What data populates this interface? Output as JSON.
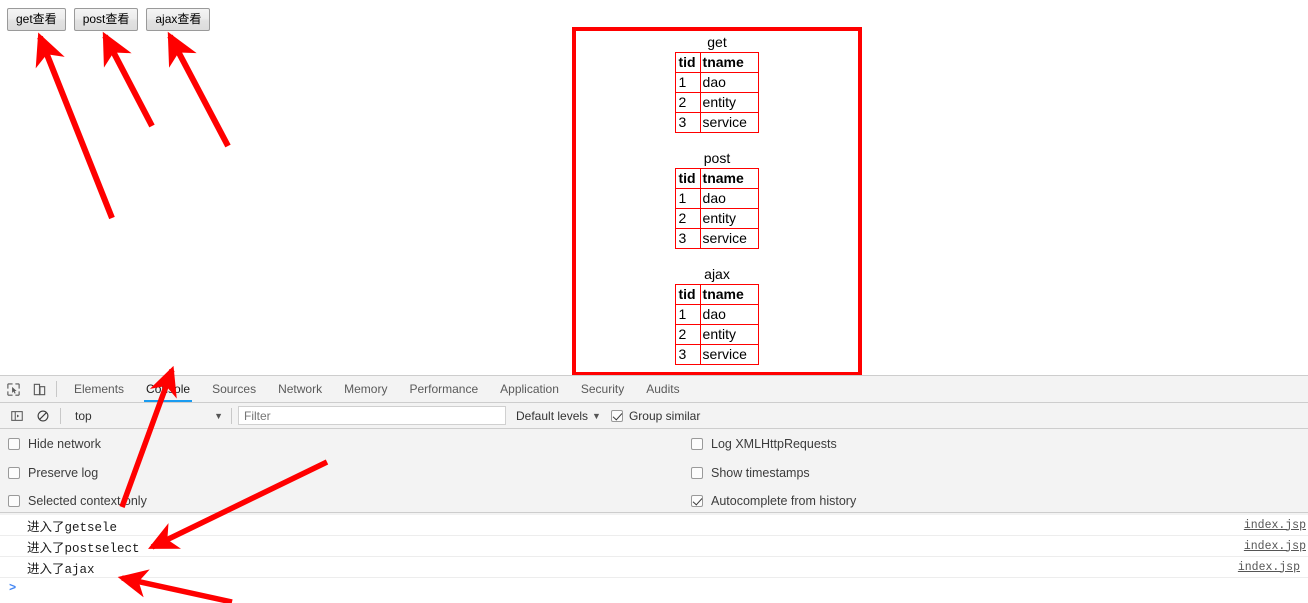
{
  "page": {
    "buttons": [
      {
        "label": "get查看",
        "name": "get-view-button"
      },
      {
        "label": "post查看",
        "name": "post-view-button"
      },
      {
        "label": "ajax查看",
        "name": "ajax-view-button"
      }
    ],
    "result_box": {
      "border_color": "#ff0000",
      "tables": [
        {
          "caption": "get",
          "columns": [
            "tid",
            "tname"
          ],
          "rows": [
            [
              "1",
              "dao"
            ],
            [
              "2",
              "entity"
            ],
            [
              "3",
              "service"
            ]
          ]
        },
        {
          "caption": "post",
          "columns": [
            "tid",
            "tname"
          ],
          "rows": [
            [
              "1",
              "dao"
            ],
            [
              "2",
              "entity"
            ],
            [
              "3",
              "service"
            ]
          ]
        },
        {
          "caption": "ajax",
          "columns": [
            "tid",
            "tname"
          ],
          "rows": [
            [
              "1",
              "dao"
            ],
            [
              "2",
              "entity"
            ],
            [
              "3",
              "service"
            ]
          ]
        }
      ]
    }
  },
  "devtools": {
    "accent_color": "#1a9bf0",
    "left_icons": [
      {
        "name": "inspect-element-icon"
      },
      {
        "name": "device-toolbar-icon"
      }
    ],
    "tabs": [
      {
        "label": "Elements",
        "active": false
      },
      {
        "label": "Console",
        "active": true
      },
      {
        "label": "Sources",
        "active": false
      },
      {
        "label": "Network",
        "active": false
      },
      {
        "label": "Memory",
        "active": false
      },
      {
        "label": "Performance",
        "active": false
      },
      {
        "label": "Application",
        "active": false
      },
      {
        "label": "Security",
        "active": false
      },
      {
        "label": "Audits",
        "active": false
      }
    ],
    "console_toolbar": {
      "sidebar_toggle_icon": "console-sidebar-icon",
      "clear_icon": "clear-console-icon",
      "context": "top",
      "context_caret": "▼",
      "filter_placeholder": "Filter",
      "levels_label": "Default levels",
      "levels_caret": "▼",
      "group_similar_label": "Group similar",
      "group_similar_checked": true
    },
    "settings": {
      "left_column": [
        {
          "label": "Hide network",
          "checked": false
        },
        {
          "label": "Preserve log",
          "checked": false
        },
        {
          "label": "Selected context only",
          "checked": false
        }
      ],
      "right_column": [
        {
          "label": "Log XMLHttpRequests",
          "checked": false
        },
        {
          "label": "Show timestamps",
          "checked": false
        },
        {
          "label": "Autocomplete from history",
          "checked": true
        }
      ]
    },
    "console_log": {
      "entries": [
        {
          "message": "进入了getsele",
          "source": "index.jsp"
        },
        {
          "message": "进入了postselect",
          "source": "index.jsp"
        },
        {
          "message": "进入了ajax",
          "source": "index.jsp"
        }
      ],
      "prompt": ">"
    }
  },
  "annotations": {
    "color": "#ff0000",
    "arrows": [
      {
        "name": "arrow-to-get-button"
      },
      {
        "name": "arrow-to-post-button"
      },
      {
        "name": "arrow-to-ajax-button"
      },
      {
        "name": "arrow-to-console-tab"
      },
      {
        "name": "arrow-to-postselect-log"
      },
      {
        "name": "arrow-to-ajax-log"
      }
    ]
  }
}
